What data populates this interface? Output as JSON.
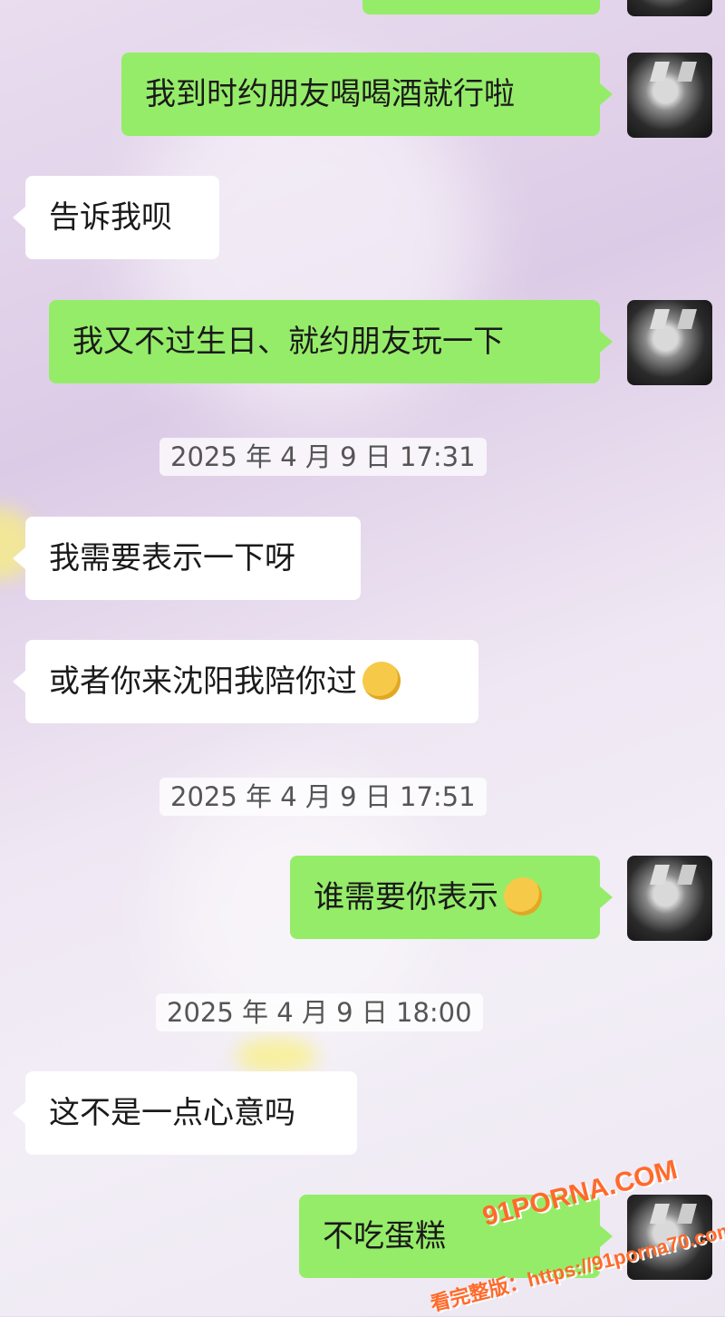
{
  "messages": [
    {
      "type": "me",
      "text": "我到时约朋友喝喝酒就行啦"
    },
    {
      "type": "them",
      "text": "告诉我呗"
    },
    {
      "type": "me",
      "text": "我又不过生日、就约朋友玩一下"
    },
    {
      "type": "time",
      "text": "2025 年 4 月 9 日 17:31"
    },
    {
      "type": "them",
      "text": "我需要表示一下呀"
    },
    {
      "type": "them",
      "text": "或者你来沈阳我陪你过"
    },
    {
      "type": "time",
      "text": "2025 年 4 月 9 日 17:51"
    },
    {
      "type": "me",
      "text": "谁需要你表示"
    },
    {
      "type": "time",
      "text": "2025 年 4 月 9 日 18:00"
    },
    {
      "type": "them",
      "text": "这不是一点心意吗"
    },
    {
      "type": "me",
      "text": "不吃蛋糕"
    }
  ],
  "emojis": {
    "m6": "winking-tongue-emoji",
    "m8": "hand-over-mouth-emoji"
  },
  "watermark": {
    "line1": "91PORNA.COM",
    "line2": "看完整版：https://91porna70.com"
  },
  "colors": {
    "me_bubble": "#95ec69",
    "them_bubble": "#ffffff"
  }
}
